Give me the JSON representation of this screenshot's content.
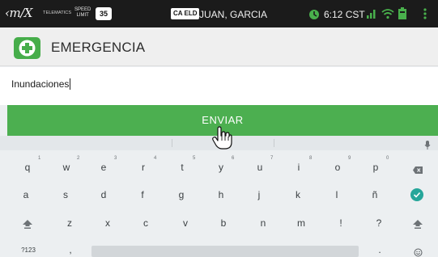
{
  "status_bar": {
    "logo": "‹m/X",
    "telematics": "TELEMATICS",
    "speed_label_line1": "SPEED",
    "speed_label_line2": "LIMIT",
    "speed_limit": "35",
    "eld_badge": "CA ELD",
    "driver_name": "JUAN, GARCIA",
    "time": "6:12 CST",
    "icons": [
      "clock-icon",
      "signal-icon",
      "wifi-icon",
      "battery-icon",
      "overflow-menu-icon"
    ]
  },
  "app_bar": {
    "icon": "plus-icon",
    "title": "EMERGENCIA"
  },
  "message": {
    "value": "Inundaciones"
  },
  "send_button": {
    "label": "ENVIAR"
  },
  "keyboard": {
    "row1": [
      "q",
      "w",
      "e",
      "r",
      "t",
      "y",
      "u",
      "i",
      "o",
      "p"
    ],
    "row1_hints": [
      "1",
      "2",
      "3",
      "4",
      "5",
      "6",
      "7",
      "8",
      "9",
      "0"
    ],
    "row2": [
      "a",
      "s",
      "d",
      "f",
      "g",
      "h",
      "j",
      "k",
      "l",
      "ñ"
    ],
    "row3": [
      "z",
      "x",
      "c",
      "v",
      "b",
      "n",
      "m",
      "!",
      "?"
    ],
    "symbols_key": "?123",
    "comma_key": ",",
    "period_key": ".",
    "accent_color": "#26a69a"
  }
}
